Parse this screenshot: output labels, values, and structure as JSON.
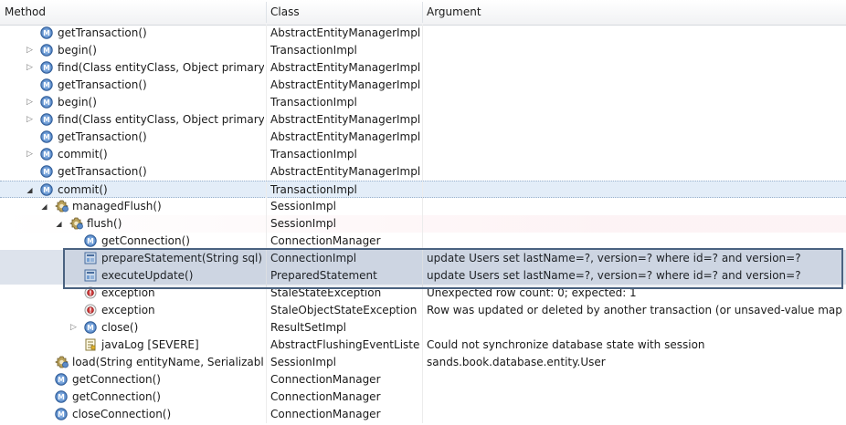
{
  "columns": {
    "method": "Method",
    "class": "Class",
    "argument": "Argument"
  },
  "rows": [
    {
      "method": "getTransaction()",
      "class": "AbstractEntityManagerImpl",
      "argument": "",
      "icon": "method-icon",
      "level": 0,
      "twisty": ""
    },
    {
      "method": "begin()",
      "class": "TransactionImpl",
      "argument": "",
      "icon": "method-icon",
      "level": 0,
      "twisty": "collapsed"
    },
    {
      "method": "find(Class entityClass, Object primaryKey)",
      "class": "AbstractEntityManagerImpl",
      "argument": "",
      "icon": "method-icon",
      "level": 0,
      "twisty": "collapsed"
    },
    {
      "method": "getTransaction()",
      "class": "AbstractEntityManagerImpl",
      "argument": "",
      "icon": "method-icon",
      "level": 0,
      "twisty": ""
    },
    {
      "method": "begin()",
      "class": "TransactionImpl",
      "argument": "",
      "icon": "method-icon",
      "level": 0,
      "twisty": "collapsed"
    },
    {
      "method": "find(Class entityClass, Object primaryKey)",
      "class": "AbstractEntityManagerImpl",
      "argument": "",
      "icon": "method-icon",
      "level": 0,
      "twisty": "collapsed"
    },
    {
      "method": "getTransaction()",
      "class": "AbstractEntityManagerImpl",
      "argument": "",
      "icon": "method-icon",
      "level": 0,
      "twisty": ""
    },
    {
      "method": "commit()",
      "class": "TransactionImpl",
      "argument": "",
      "icon": "method-icon",
      "level": 0,
      "twisty": "collapsed"
    },
    {
      "method": "getTransaction()",
      "class": "AbstractEntityManagerImpl",
      "argument": "",
      "icon": "method-icon",
      "level": 0,
      "twisty": ""
    },
    {
      "method": "commit()",
      "class": "TransactionImpl",
      "argument": "",
      "icon": "method-icon",
      "level": 0,
      "twisty": "expanded",
      "selected": true
    },
    {
      "method": "managedFlush()",
      "class": "SessionImpl",
      "argument": "",
      "icon": "gear-method-icon",
      "level": 1,
      "twisty": "expanded"
    },
    {
      "method": "flush()",
      "class": "SessionImpl",
      "argument": "",
      "icon": "gear-method-icon",
      "level": 2,
      "twisty": "expanded",
      "pink": true
    },
    {
      "method": "getConnection()",
      "class": "ConnectionManager",
      "argument": "",
      "icon": "method-icon",
      "level": 3,
      "twisty": ""
    },
    {
      "method": "prepareStatement(String sql)",
      "class": "ConnectionImpl",
      "argument": "update Users set lastName=?, version=? where id=? and version=?",
      "icon": "sql-statement-icon",
      "level": 3,
      "twisty": "",
      "highlight": true
    },
    {
      "method": "executeUpdate()",
      "class": "PreparedStatement",
      "argument": "update Users set lastName=?, version=? where id=? and version=?",
      "icon": "sql-statement-icon",
      "level": 3,
      "twisty": "",
      "highlight": true
    },
    {
      "method": "exception",
      "class": "StaleStateException",
      "argument": "Unexpected row count: 0; expected: 1",
      "icon": "exception-icon",
      "level": 3,
      "twisty": ""
    },
    {
      "method": "exception",
      "class": "StaleObjectStateException",
      "argument": "Row was updated or deleted by another transaction (or unsaved-value mapping was…",
      "icon": "exception-icon",
      "level": 3,
      "twisty": ""
    },
    {
      "method": "close()",
      "class": "ResultSetImpl",
      "argument": "",
      "icon": "method-icon",
      "level": 3,
      "twisty": "collapsed"
    },
    {
      "method": "javaLog [SEVERE]",
      "class": "AbstractFlushingEventListen…",
      "argument": "Could not synchronize database state with session",
      "icon": "log-icon",
      "level": 3,
      "twisty": ""
    },
    {
      "method": "load(String entityName, Serializable id)",
      "class": "SessionImpl",
      "argument": "sands.book.database.entity.User",
      "icon": "gear-method-icon",
      "level": 1,
      "twisty": ""
    },
    {
      "method": "getConnection()",
      "class": "ConnectionManager",
      "argument": "",
      "icon": "method-icon",
      "level": 1,
      "twisty": ""
    },
    {
      "method": "getConnection()",
      "class": "ConnectionManager",
      "argument": "",
      "icon": "method-icon",
      "level": 1,
      "twisty": ""
    },
    {
      "method": "closeConnection()",
      "class": "ConnectionManager",
      "argument": "",
      "icon": "method-icon",
      "level": 1,
      "twisty": ""
    }
  ]
}
